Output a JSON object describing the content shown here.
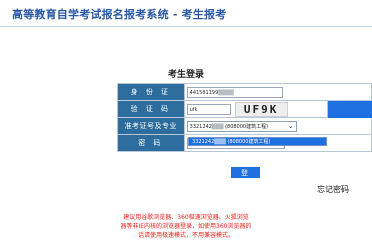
{
  "site": {
    "title": "高等教育自学考试报名报考系统 - 考生报考"
  },
  "login": {
    "title": "考生登录",
    "id_label": "身 份 证",
    "id_value": "441581199",
    "captcha_label": "验 证 码",
    "captcha_value": "ufk",
    "captcha_image_text": "UF9K",
    "major_label": "准考证号及专业",
    "major_selected": "3321242",
    "major_selected_suffix": "(808000建筑工程)",
    "dropdown_option": "3321242",
    "dropdown_option_suffix": "(808000建筑工程)",
    "password_label": "密 码",
    "submit_label": "登 录",
    "forgot_label": "忘记密码"
  },
  "notice": {
    "lines": [
      "建议用谷歌浏览器、360极速浏览器、火狐浏览",
      "器等非IE内核的浏览器登录，如使用360浏览器的",
      "话请使用极速模式，不用兼容模式。"
    ]
  },
  "colors": {
    "title_blue": "#2a58a5",
    "label_bg": "#2c6d9d",
    "button_blue": "#1e6fe0",
    "notice_red": "#e8211b"
  }
}
